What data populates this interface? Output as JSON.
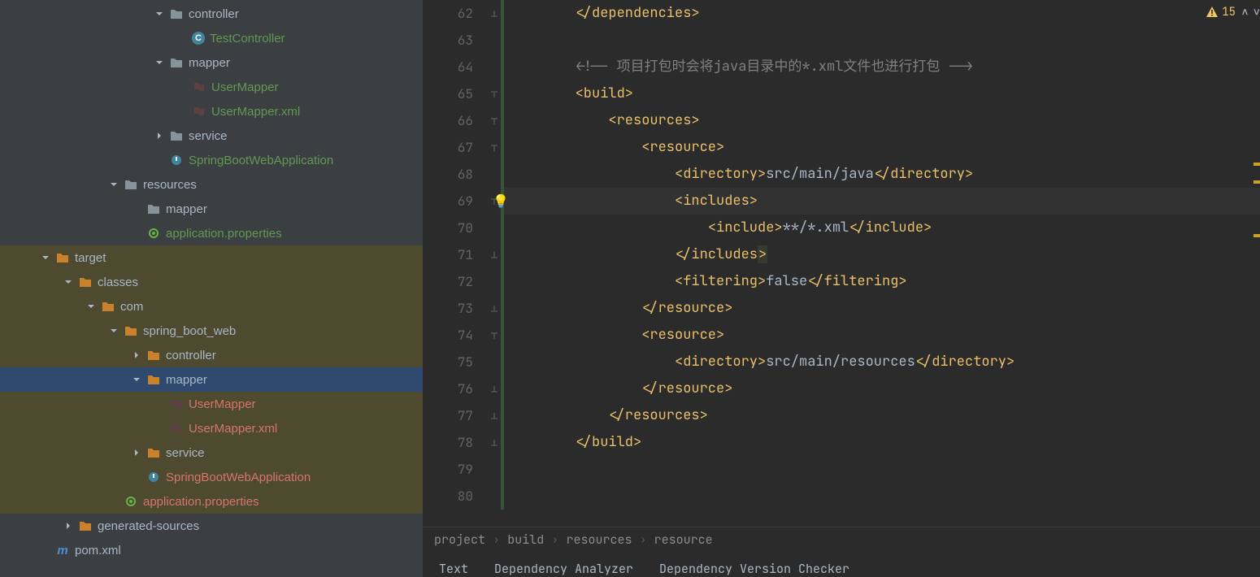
{
  "tree": [
    {
      "depth": 6,
      "arrow": "down",
      "icon": "folder",
      "label": "controller",
      "color": "grey"
    },
    {
      "depth": 7,
      "arrow": "",
      "icon": "class-c",
      "label": "TestController",
      "color": "green"
    },
    {
      "depth": 6,
      "arrow": "down",
      "icon": "folder",
      "label": "mapper",
      "color": "grey"
    },
    {
      "depth": 7,
      "arrow": "",
      "icon": "xml",
      "label": "UserMapper",
      "color": "green"
    },
    {
      "depth": 7,
      "arrow": "",
      "icon": "xml",
      "label": "UserMapper.xml",
      "color": "green"
    },
    {
      "depth": 6,
      "arrow": "right",
      "icon": "folder",
      "label": "service",
      "color": "grey"
    },
    {
      "depth": 6,
      "arrow": "",
      "icon": "spring",
      "label": "SpringBootWebApplication",
      "color": "green"
    },
    {
      "depth": 4,
      "arrow": "down",
      "icon": "folder",
      "label": "resources",
      "color": "grey"
    },
    {
      "depth": 5,
      "arrow": "",
      "icon": "folder",
      "label": "mapper",
      "color": "grey"
    },
    {
      "depth": 5,
      "arrow": "",
      "icon": "props",
      "label": "application.properties",
      "color": "green"
    },
    {
      "depth": 1,
      "arrow": "down",
      "icon": "folder-orange",
      "label": "target",
      "color": "grey",
      "hl": true
    },
    {
      "depth": 2,
      "arrow": "down",
      "icon": "folder-orange",
      "label": "classes",
      "color": "grey",
      "hl": true
    },
    {
      "depth": 3,
      "arrow": "down",
      "icon": "folder-orange",
      "label": "com",
      "color": "grey",
      "hl": true
    },
    {
      "depth": 4,
      "arrow": "down",
      "icon": "folder-orange",
      "label": "spring_boot_web",
      "color": "grey",
      "hl": true
    },
    {
      "depth": 5,
      "arrow": "right",
      "icon": "folder-orange",
      "label": "controller",
      "color": "grey",
      "hl": true
    },
    {
      "depth": 5,
      "arrow": "down",
      "icon": "folder-orange",
      "label": "mapper",
      "color": "grey",
      "selected": true
    },
    {
      "depth": 6,
      "arrow": "",
      "icon": "xml",
      "label": "UserMapper",
      "color": "red2",
      "hl": true
    },
    {
      "depth": 6,
      "arrow": "",
      "icon": "xml",
      "label": "UserMapper.xml",
      "color": "red2",
      "hl": true
    },
    {
      "depth": 5,
      "arrow": "right",
      "icon": "folder-orange",
      "label": "service",
      "color": "grey",
      "hl": true
    },
    {
      "depth": 5,
      "arrow": "",
      "icon": "spring",
      "label": "SpringBootWebApplication",
      "color": "red2",
      "hl": true
    },
    {
      "depth": 4,
      "arrow": "",
      "icon": "props",
      "label": "application.properties",
      "color": "red2",
      "hl": true
    },
    {
      "depth": 2,
      "arrow": "right",
      "icon": "folder-orange",
      "label": "generated-sources",
      "color": "grey"
    },
    {
      "depth": 1,
      "arrow": "",
      "icon": "pom",
      "label": "pom.xml",
      "color": "grey"
    }
  ],
  "lines": [
    {
      "n": 62,
      "fold": "up",
      "segs": [
        {
          "t": "        ",
          "c": ""
        },
        {
          "t": "</dependencies>",
          "c": "t-tag"
        }
      ]
    },
    {
      "n": 63,
      "segs": [
        {
          "t": "",
          "c": ""
        }
      ]
    },
    {
      "n": 64,
      "segs": [
        {
          "t": "        ",
          "c": ""
        },
        {
          "t": "<!-- 项目打包时会将java目录中的*.xml文件也进行打包 -->",
          "c": "t-cm"
        }
      ]
    },
    {
      "n": 65,
      "fold": "dn",
      "segs": [
        {
          "t": "        ",
          "c": ""
        },
        {
          "t": "<build>",
          "c": "t-tag"
        }
      ]
    },
    {
      "n": 66,
      "fold": "dn",
      "segs": [
        {
          "t": "            ",
          "c": ""
        },
        {
          "t": "<resources>",
          "c": "t-tag"
        }
      ]
    },
    {
      "n": 67,
      "fold": "dn",
      "segs": [
        {
          "t": "                ",
          "c": ""
        },
        {
          "t": "<resource>",
          "c": "t-tag"
        }
      ]
    },
    {
      "n": 68,
      "segs": [
        {
          "t": "                    ",
          "c": ""
        },
        {
          "t": "<directory>",
          "c": "t-tag"
        },
        {
          "t": "src/main/java",
          "c": "t-text"
        },
        {
          "t": "</directory>",
          "c": "t-tag"
        }
      ]
    },
    {
      "n": 69,
      "fold": "dn",
      "cursor": true,
      "lamp": true,
      "segs": [
        {
          "t": "                    ",
          "c": ""
        },
        {
          "t": "<includes>",
          "c": "t-tag"
        }
      ]
    },
    {
      "n": 70,
      "segs": [
        {
          "t": "                        ",
          "c": ""
        },
        {
          "t": "<include>",
          "c": "t-tag"
        },
        {
          "t": "**/*.xml",
          "c": "t-text"
        },
        {
          "t": "</include>",
          "c": "t-tag"
        }
      ]
    },
    {
      "n": 71,
      "fold": "up",
      "segs": [
        {
          "t": "                    ",
          "c": ""
        },
        {
          "t": "</includes",
          "c": "t-tag"
        },
        {
          "t": ">",
          "c": "t-tag caretbar"
        }
      ]
    },
    {
      "n": 72,
      "segs": [
        {
          "t": "                    ",
          "c": ""
        },
        {
          "t": "<filtering>",
          "c": "t-tag"
        },
        {
          "t": "false",
          "c": "t-text"
        },
        {
          "t": "</filtering>",
          "c": "t-tag"
        }
      ]
    },
    {
      "n": 73,
      "fold": "up",
      "segs": [
        {
          "t": "                ",
          "c": ""
        },
        {
          "t": "</resource>",
          "c": "t-tag"
        }
      ]
    },
    {
      "n": 74,
      "fold": "dn",
      "segs": [
        {
          "t": "                ",
          "c": ""
        },
        {
          "t": "<resource>",
          "c": "t-tag"
        }
      ]
    },
    {
      "n": 75,
      "segs": [
        {
          "t": "                    ",
          "c": ""
        },
        {
          "t": "<directory>",
          "c": "t-tag"
        },
        {
          "t": "src/main/resources",
          "c": "t-text"
        },
        {
          "t": "</directory>",
          "c": "t-tag"
        }
      ]
    },
    {
      "n": 76,
      "fold": "up",
      "segs": [
        {
          "t": "                ",
          "c": ""
        },
        {
          "t": "</resource>",
          "c": "t-tag"
        }
      ]
    },
    {
      "n": 77,
      "fold": "up",
      "segs": [
        {
          "t": "            ",
          "c": ""
        },
        {
          "t": "</resources>",
          "c": "t-tag"
        }
      ]
    },
    {
      "n": 78,
      "fold": "up",
      "segs": [
        {
          "t": "        ",
          "c": ""
        },
        {
          "t": "</build>",
          "c": "t-tag"
        }
      ]
    },
    {
      "n": 79,
      "segs": [
        {
          "t": "",
          "c": ""
        }
      ]
    },
    {
      "n": 80,
      "segs": [
        {
          "t": "",
          "c": ""
        }
      ]
    }
  ],
  "warnings": "15",
  "breadcrumbs": [
    "project",
    "build",
    "resources",
    "resource"
  ],
  "tabs": [
    "Text",
    "Dependency Analyzer",
    "Dependency Version Checker"
  ]
}
